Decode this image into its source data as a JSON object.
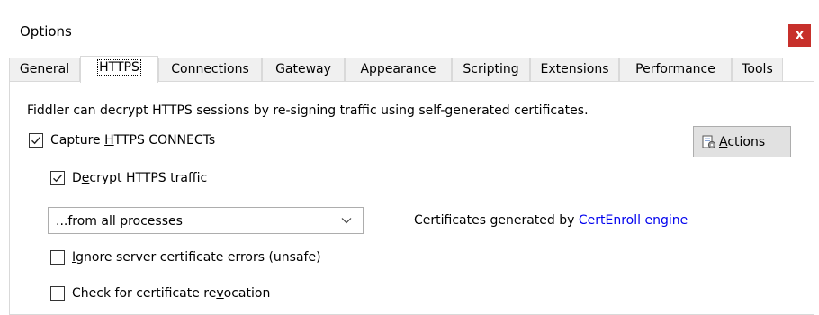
{
  "window": {
    "title": "Options",
    "close_label": "x"
  },
  "tabs": [
    {
      "label": "General"
    },
    {
      "label": "HTTPS",
      "selected": true
    },
    {
      "label": "Connections"
    },
    {
      "label": "Gateway"
    },
    {
      "label": "Appearance"
    },
    {
      "label": "Scripting"
    },
    {
      "label": "Extensions"
    },
    {
      "label": "Performance"
    },
    {
      "label": "Tools"
    }
  ],
  "https": {
    "description": "Fiddler can decrypt HTTPS sessions by re-signing traffic using self-generated certificates.",
    "capture_connects": {
      "label_pre": "Capture ",
      "label_accel": "H",
      "label_post": "TTPS CONNECTs",
      "checked": true
    },
    "decrypt_traffic": {
      "label_pre": "D",
      "label_accel": "e",
      "label_post": "crypt HTTPS traffic",
      "checked": true
    },
    "process_filter": {
      "value": "...from all processes"
    },
    "ignore_errors": {
      "label_pre": "",
      "label_accel": "I",
      "label_post": "gnore server certificate errors (unsafe)",
      "checked": false
    },
    "check_revocation": {
      "label_pre": "Check for certificate re",
      "label_accel": "v",
      "label_post": "ocation",
      "checked": false
    },
    "actions_button": {
      "label_accel": "A",
      "label_post": "ctions"
    },
    "cert_info": {
      "text": "Certificates generated by ",
      "link": "CertEnroll engine"
    }
  },
  "colors": {
    "close_button": "#c7302b",
    "link": "#0000ee",
    "tab_border": "#d9d9d9",
    "button_face": "#e1e1e1"
  },
  "icons": {
    "close": "close-icon",
    "actions": "certificate-gear-icon",
    "dropdown": "chevron-down-icon",
    "check": "checkmark-icon"
  }
}
